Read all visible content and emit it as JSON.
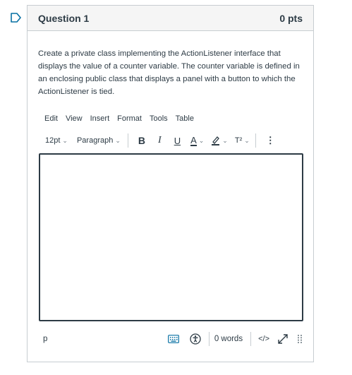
{
  "question": {
    "title": "Question 1",
    "points": "0 pts",
    "text": "Create a private class implementing the ActionListener interface that displays the value of a counter variable. The counter variable is defined in an enclosing public class that displays a panel with a button to which the ActionListener is tied."
  },
  "menubar": [
    "Edit",
    "View",
    "Insert",
    "Format",
    "Tools",
    "Table"
  ],
  "toolbar": {
    "font_size": "12pt",
    "block_format": "Paragraph",
    "bold": "B",
    "italic": "I",
    "underline": "U",
    "text_color": "A",
    "superscript": "T²",
    "more": "⋮"
  },
  "editor": {
    "content": ""
  },
  "statusbar": {
    "path": "p",
    "word_count": "0 words",
    "html_toggle": "</>"
  },
  "icons": {
    "flag": "bookmark-flag-icon",
    "keyboard": "keyboard-icon",
    "accessibility": "accessibility-icon",
    "fullscreen": "fullscreen-icon",
    "resize": "resize-handle-icon"
  },
  "colors": {
    "accent": "#0770a3",
    "text": "#2d3b45",
    "border": "#c7cdd1"
  }
}
